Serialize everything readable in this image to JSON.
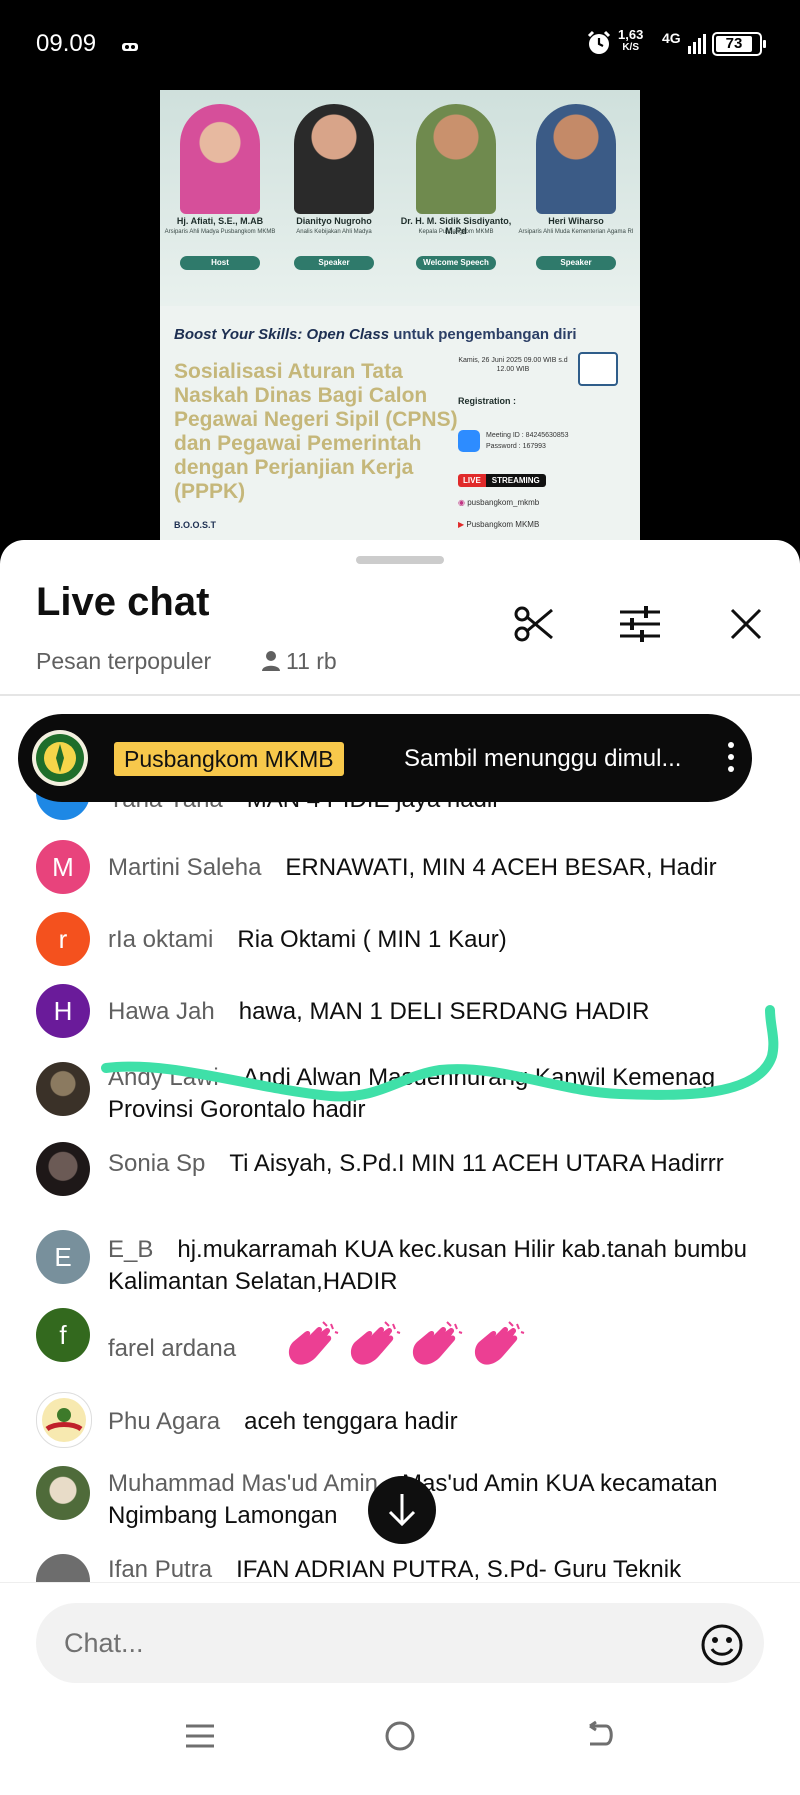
{
  "status_bar": {
    "time": "09.09",
    "net_speed_value": "1,63",
    "net_speed_unit": "K/S",
    "network": "4G",
    "battery": "73"
  },
  "poster": {
    "speakers": [
      {
        "name": "Hj. Afiati, S.E., M.AB",
        "title": "Arsiparis Ahli Madya Pusbangkom MKMB",
        "role": "Host"
      },
      {
        "name": "Dianityo Nugroho",
        "title": "Analis Kebijakan Ahli Madya",
        "role": "Speaker"
      },
      {
        "name": "Dr. H. M. Sidik Sisdiyanto, M.Pd",
        "title": "Kepala Pusbangkom MKMB",
        "role": "Welcome Speech"
      },
      {
        "name": "Heri Wiharso",
        "title": "Arsiparis Ahli Muda Kementerian Agama RI",
        "role": "Speaker"
      }
    ],
    "boost_line_bold": "Boost Your Skills: Open Class",
    "boost_line_rest": " untuk pengembangan diri",
    "headline": "Sosialisasi Aturan Tata Naskah Dinas Bagi Calon Pegawai Negeri Sipil (CPNS) dan Pegawai Pemerintah dengan Perjanjian Kerja (PPPK)",
    "date": "Kamis, 26 Juni 2025 09.00 WIB s.d 12.00 WIB",
    "registration_label": "Registration :",
    "meeting_id": "Meeting ID : 84245630853",
    "password": "Password : 167993",
    "live_label": "LIVE",
    "streaming_label": "STREAMING",
    "instagram": "pusbangkom_mkmb",
    "youtube": "Pusbangkom MKMB",
    "boost_acronym": "B.O.O.S.T"
  },
  "chat": {
    "title": "Live chat",
    "filter_label": "Pesan terpopuler",
    "viewer_count": "11 rb",
    "pinned": {
      "author": "Pusbangkom MKMB",
      "message": "Sambil menunggu dimul..."
    },
    "messages": [
      {
        "initial": "Y",
        "color": "#1e88e5",
        "author": "Yana Yana",
        "text": "MAN 4 PIDIE jaya hadir"
      },
      {
        "initial": "M",
        "color": "#e8437c",
        "author": "Martini Saleha",
        "text": "ERNAWATI, MIN 4 ACEH BESAR, Hadir"
      },
      {
        "initial": "r",
        "color": "#f4511e",
        "author": "rIa oktami",
        "text": "Ria Oktami ( MIN 1 Kaur)"
      },
      {
        "initial": "H",
        "color": "#6a1b9a",
        "author": "Hawa Jah",
        "text": "hawa, MAN 1 DELI SERDANG HADIR"
      },
      {
        "initial": "",
        "color": "#5a4a3a",
        "author": "Andy Lawi",
        "text": "Andi Alwan Masuennurang Kanwil Kemenag Provinsi Gorontalo hadir"
      },
      {
        "initial": "",
        "color": "#3d3535",
        "author": "Sonia Sp",
        "text": "Ti Aisyah, S.Pd.I MIN 11 ACEH UTARA Hadirrr"
      },
      {
        "initial": "E",
        "color": "#78909c",
        "author": "E_B",
        "text": "hj.mukarramah KUA kec.kusan Hilir kab.tanah bumbu Kalimantan Selatan,HADIR"
      },
      {
        "initial": "f",
        "color": "#33691e",
        "author": "farel ardana",
        "text": ""
      },
      {
        "initial": "",
        "color": "#f5f0e0",
        "author": "Phu Agara",
        "text": "aceh tenggara hadir"
      },
      {
        "initial": "",
        "color": "#7a8a5a",
        "author": "Muhammad Mas'ud Amin",
        "text": "Mas'ud Amin KUA kecamatan Ngimbang Lamongan"
      },
      {
        "initial": "",
        "color": "#6d6d6d",
        "author": "Ifan Putra",
        "text": "IFAN ADRIAN PUTRA, S.Pd- Guru Teknik"
      }
    ],
    "input_placeholder": "Chat..."
  },
  "colors": {
    "pinned_badge": "#f7c84b",
    "marker": "#3fe0a8"
  }
}
